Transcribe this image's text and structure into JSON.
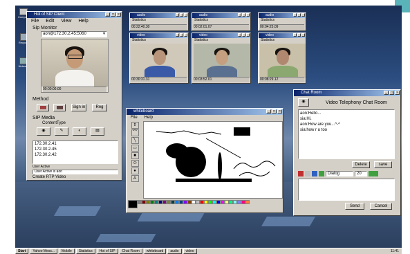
{
  "sip_client": {
    "title": "Hot of SIP Client",
    "menu": [
      "File",
      "Edit",
      "View",
      "Help"
    ],
    "monitor_label": "Sip Monitor",
    "address": "aon@172.30.2.45:5060",
    "video_status": "00:00:00.00",
    "method_label": "Method",
    "signin": "Sign in",
    "reg": "Reg",
    "media_label": "SIP Media",
    "content_type_label": "ContentType",
    "ip_list": [
      "172.30.2.41",
      "172.30.2.45",
      "172.30.2.42"
    ],
    "user_active": "User Active",
    "user_active_line": "User Active is aon",
    "create_rtp": "Create RTP Video"
  },
  "video_windows": [
    {
      "title": "audio",
      "stats": "Statistics",
      "time": "00:22:40.30"
    },
    {
      "title": "audio",
      "stats": "Statistics",
      "time": "00:02:01.07"
    },
    {
      "title": "audio",
      "stats": "Statistics",
      "time": "00:04:25.09"
    },
    {
      "title": "video",
      "stats": "Statistics",
      "time": "00:30:31.31"
    },
    {
      "title": "video",
      "stats": "Statistics",
      "time": "00:03:52.01"
    },
    {
      "title": "video",
      "stats": "Statistics",
      "time": "00:08:29.12"
    }
  ],
  "whiteboard": {
    "title": "whiteboard",
    "menu": [
      "File",
      "Help"
    ],
    "tools": [
      "⇕",
      "⌒",
      "╲",
      "▭",
      "■",
      "⬭",
      "●",
      "A"
    ],
    "palette": [
      "#000000",
      "#808080",
      "#800000",
      "#808000",
      "#008000",
      "#008080",
      "#000080",
      "#800080",
      "#808040",
      "#004040",
      "#0080ff",
      "#004080",
      "#8000ff",
      "#804000",
      "#ffffff",
      "#c0c0c0",
      "#ff0000",
      "#ffff00",
      "#00ff00",
      "#00ffff",
      "#0000ff",
      "#ff00ff",
      "#ffff80",
      "#00ff80",
      "#80ffff",
      "#8080ff",
      "#ff0080",
      "#ff8040"
    ]
  },
  "chat": {
    "title": "Chat Room",
    "heading": "Video Telephony Chat Room",
    "messages": [
      "aon:Hello...",
      "sia:Hi.",
      "aon:How are you...^-^",
      "sia:how r u too"
    ],
    "delete": "Delete",
    "save": "save",
    "font": "Dialog",
    "font_size": "20",
    "send": "Send",
    "cancel": "Cancel"
  },
  "taskbar": {
    "start": "Start",
    "items": [
      "Yahoo Mess...",
      "Mobile",
      "Statistics",
      "Hot of SIP",
      "Chat Room",
      "whiteboard",
      "audio",
      "video"
    ],
    "clock": "11:41"
  },
  "desktop_icons": [
    "Computer",
    "Recycle",
    "Network",
    "Recycle Bin"
  ]
}
